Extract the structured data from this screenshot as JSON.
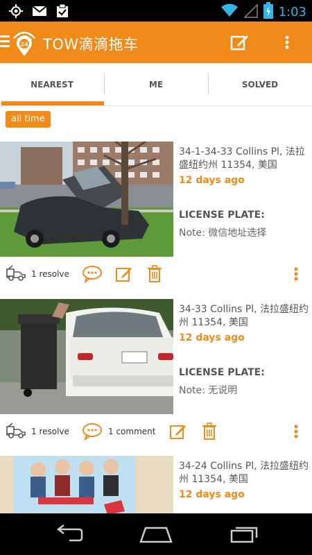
{
  "status_bar": {
    "time": "1:03",
    "left_icons": [
      "gps-icon",
      "gmail-icon",
      "clipboard-check-icon"
    ],
    "right_icons": [
      "wifi-icon",
      "signal-icon",
      "battery-charging-icon"
    ]
  },
  "action_bar": {
    "title": "TOW滴滴拖车",
    "logo_badge": "24",
    "actions": [
      "compose-icon",
      "overflow-menu-icon"
    ],
    "color": "#f08a1a"
  },
  "tabs": [
    {
      "label": "NEAREST",
      "selected": true
    },
    {
      "label": "ME",
      "selected": false
    },
    {
      "label": "SOLVED",
      "selected": false
    }
  ],
  "filter": {
    "label": "all time"
  },
  "cards": [
    {
      "address": "34-1-34-33 Collins Pl, 法拉盛纽约州 11354, 美国",
      "time_ago": "12 days ago",
      "plate_label": "LICENSE PLATE:",
      "note": "Note: 微信地址选择",
      "resolve": "1 resolve",
      "comment": ""
    },
    {
      "address": "34-33 Collins Pl, 法拉盛纽约州 11354, 美国",
      "time_ago": "12 days ago",
      "plate_label": "LICENSE PLATE:",
      "note": "Note: 无说明",
      "resolve": "1 resolve",
      "comment": "1 comment"
    },
    {
      "address": "34-24 Collins Pl, 法拉盛纽约州 11354, 美国",
      "time_ago": "12 days ago",
      "plate_label": "",
      "note": "",
      "resolve": "",
      "comment": ""
    }
  ],
  "nav_bar": [
    "back-icon",
    "home-icon",
    "recents-icon"
  ]
}
